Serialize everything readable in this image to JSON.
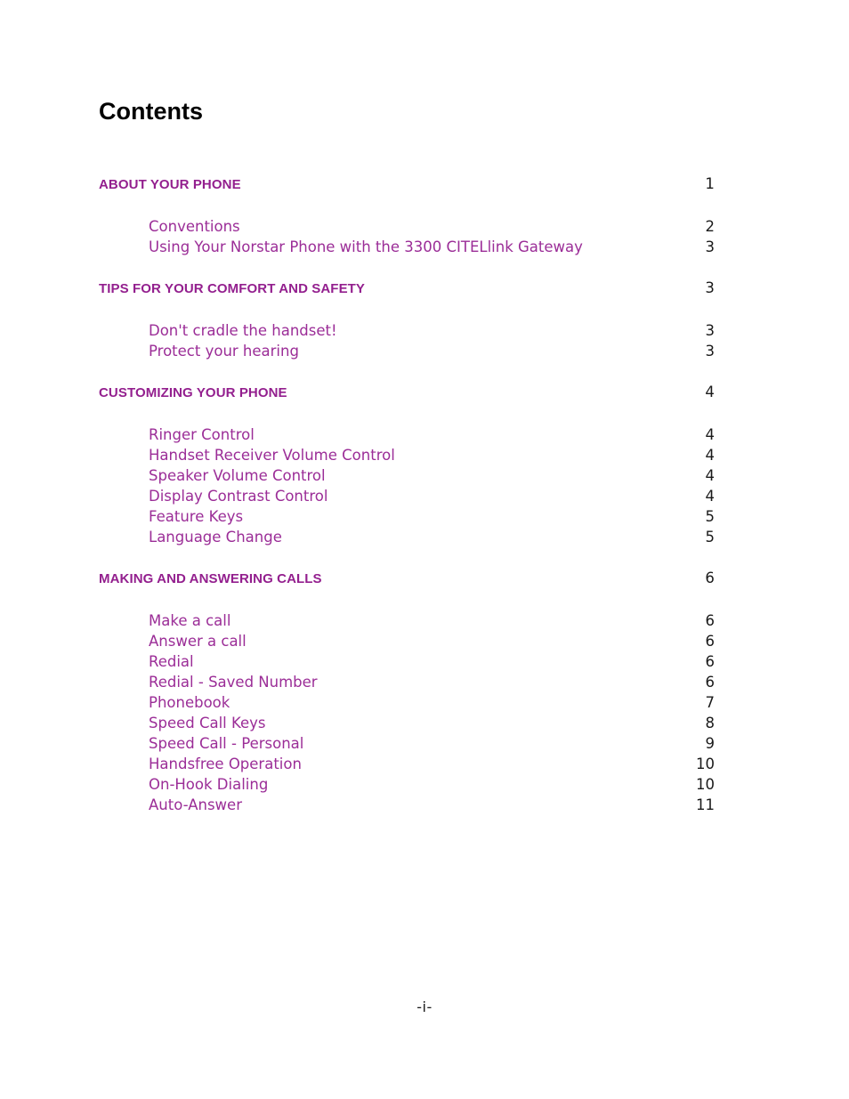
{
  "document": {
    "title": "Contents",
    "footer": "-i-",
    "accent_heading_color": "#931f8e",
    "accent_entry_color": "#9b2d97",
    "page_number_color": "#1a1a1a",
    "background_color": "#ffffff"
  },
  "sections": [
    {
      "heading": "ABOUT YOUR PHONE",
      "page": "1",
      "entries": [
        {
          "label": "Conventions",
          "page": "2"
        },
        {
          "label": "Using Your Norstar Phone with the 3300 CITELlink Gateway",
          "page": "3"
        }
      ]
    },
    {
      "heading": "TIPS FOR YOUR COMFORT AND SAFETY",
      "page": "3",
      "entries": [
        {
          "label": "Don't cradle the handset!",
          "page": "3"
        },
        {
          "label": "Protect your hearing",
          "page": "3"
        }
      ]
    },
    {
      "heading": "CUSTOMIZING YOUR PHONE",
      "page": "4",
      "entries": [
        {
          "label": "Ringer Control",
          "page": "4"
        },
        {
          "label": "Handset Receiver Volume Control",
          "page": "4"
        },
        {
          "label": "Speaker Volume Control",
          "page": "4"
        },
        {
          "label": "Display Contrast Control",
          "page": "4"
        },
        {
          "label": "Feature Keys",
          "page": "5"
        },
        {
          "label": "Language Change",
          "page": "5"
        }
      ]
    },
    {
      "heading": "MAKING AND ANSWERING CALLS",
      "page": "6",
      "entries": [
        {
          "label": "Make a call",
          "page": "6"
        },
        {
          "label": "Answer a call",
          "page": "6"
        },
        {
          "label": "Redial",
          "page": "6"
        },
        {
          "label": "Redial - Saved Number",
          "page": "6"
        },
        {
          "label": "Phonebook",
          "page": "7"
        },
        {
          "label": "Speed Call Keys",
          "page": "8"
        },
        {
          "label": "Speed Call - Personal",
          "page": "9"
        },
        {
          "label": "Handsfree Operation",
          "page": "10"
        },
        {
          "label": "On-Hook Dialing",
          "page": "10"
        },
        {
          "label": "Auto-Answer",
          "page": "11"
        }
      ]
    }
  ]
}
